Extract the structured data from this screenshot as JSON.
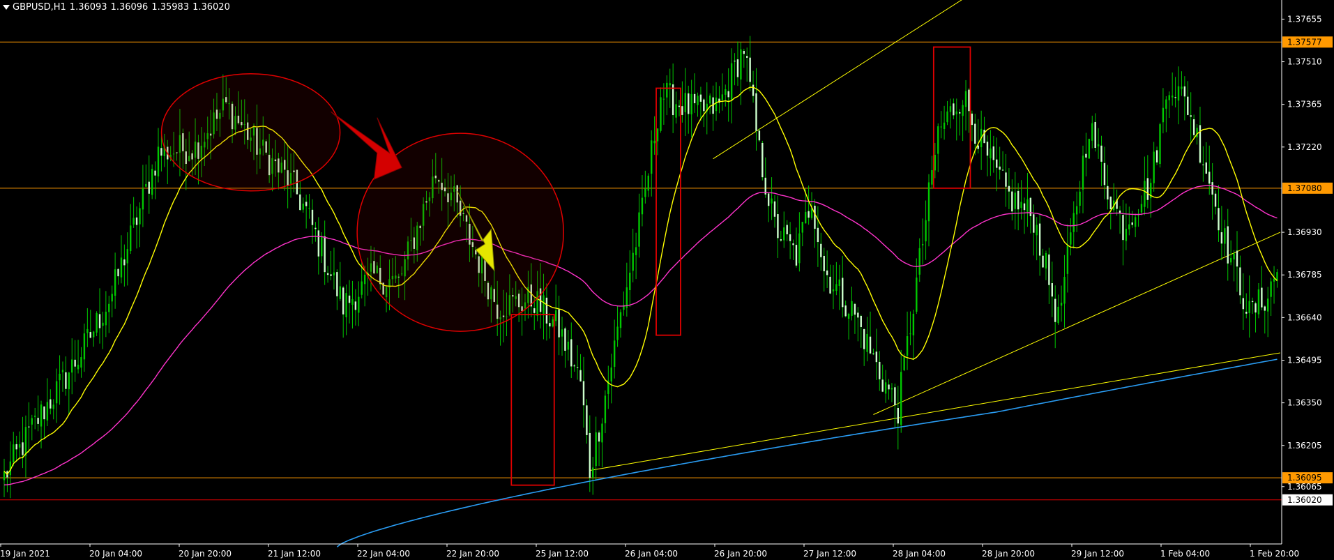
{
  "header": {
    "symbol": "GBPUSD,H1",
    "open": "1.36093",
    "high": "1.36096",
    "low": "1.35983",
    "close": "1.36020"
  },
  "colors": {
    "background": "#000000",
    "bull_candle": "#00c800",
    "bear_candle": "#ccffcc",
    "ma_fast": "#ffff00",
    "ma_mid": "#ff33cc",
    "ma_slow": "#2a9df4",
    "levels": "#ff9900",
    "annotation_red": "#e00000",
    "axis": "#ffffff"
  },
  "chart_data": {
    "type": "candlestick",
    "symbol": "GBPUSD",
    "timeframe": "H1",
    "ylim": [
      1.3587,
      1.3772
    ],
    "price_ticks": [
      "1.37655",
      "1.37510",
      "1.37365",
      "1.37220",
      "1.36930",
      "1.36785",
      "1.36640",
      "1.36495",
      "1.36350",
      "1.36205",
      "1.36065"
    ],
    "time_labels": [
      "19 Jan 2021",
      "20 Jan 04:00",
      "20 Jan 20:00",
      "21 Jan 12:00",
      "22 Jan 04:00",
      "22 Jan 20:00",
      "25 Jan 12:00",
      "26 Jan 04:00",
      "26 Jan 20:00",
      "27 Jan 12:00",
      "28 Jan 04:00",
      "28 Jan 20:00",
      "29 Jan 12:00",
      "1 Feb 04:00",
      "1 Feb 20:00"
    ],
    "levels": [
      {
        "price": 1.37577,
        "label": "1.37577",
        "kind": "horizontal-line"
      },
      {
        "price": 1.3708,
        "label": "1.37080",
        "kind": "horizontal-line"
      },
      {
        "price": 1.36095,
        "label": "1.36095",
        "kind": "horizontal-line"
      },
      {
        "price": 1.3602,
        "label": "1.36020",
        "kind": "current-price"
      }
    ],
    "anchors": [
      [
        0,
        1.361
      ],
      [
        10,
        1.3628
      ],
      [
        25,
        1.3652
      ],
      [
        35,
        1.3672
      ],
      [
        50,
        1.372
      ],
      [
        62,
        1.3722
      ],
      [
        72,
        1.3736
      ],
      [
        84,
        1.372
      ],
      [
        93,
        1.371
      ],
      [
        98,
        1.37
      ],
      [
        110,
        1.3668
      ],
      [
        120,
        1.3678
      ],
      [
        128,
        1.3676
      ],
      [
        140,
        1.3713
      ],
      [
        145,
        1.3706
      ],
      [
        160,
        1.3668
      ],
      [
        172,
        1.367
      ],
      [
        180,
        1.366
      ],
      [
        187,
        1.3642
      ],
      [
        190,
        1.3612
      ],
      [
        194,
        1.3632
      ],
      [
        200,
        1.3665
      ],
      [
        207,
        1.37
      ],
      [
        213,
        1.374
      ],
      [
        225,
        1.3734
      ],
      [
        232,
        1.3736
      ],
      [
        240,
        1.3756
      ],
      [
        245,
        1.372
      ],
      [
        250,
        1.3695
      ],
      [
        257,
        1.3685
      ],
      [
        262,
        1.3705
      ],
      [
        266,
        1.368
      ],
      [
        276,
        1.3665
      ],
      [
        284,
        1.3645
      ],
      [
        290,
        1.3633
      ],
      [
        298,
        1.369
      ],
      [
        303,
        1.3727
      ],
      [
        311,
        1.374
      ],
      [
        318,
        1.372
      ],
      [
        326,
        1.3705
      ],
      [
        334,
        1.3698
      ],
      [
        342,
        1.3663
      ],
      [
        352,
        1.373
      ],
      [
        358,
        1.3708
      ],
      [
        363,
        1.3695
      ],
      [
        372,
        1.371
      ],
      [
        378,
        1.3745
      ],
      [
        384,
        1.3736
      ],
      [
        390,
        1.3715
      ],
      [
        396,
        1.369
      ],
      [
        401,
        1.3675
      ],
      [
        404,
        1.3665
      ],
      [
        410,
        1.3672
      ],
      [
        413,
        1.368
      ]
    ],
    "annotations": [
      "two red circles over tops",
      "three red rectangles",
      "red arrow",
      "yellow arrow",
      "yellow trend lines"
    ]
  }
}
